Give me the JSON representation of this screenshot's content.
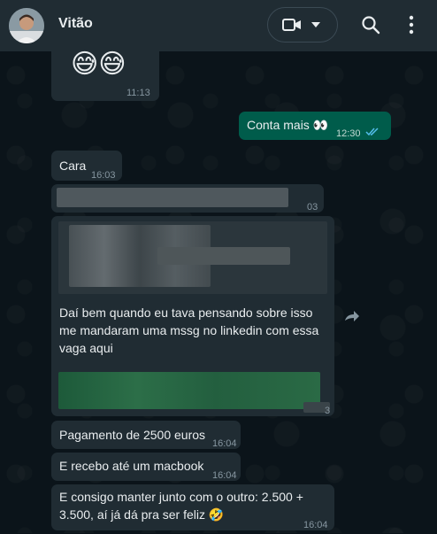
{
  "header": {
    "contact_name": "Vitão",
    "icons": {
      "video": "video-camera-icon",
      "dropdown": "chevron-down-icon",
      "search": "search-icon",
      "menu": "more-vertical-icon"
    }
  },
  "colors": {
    "header_bg": "#202c33",
    "incoming_bubble": "#202c33",
    "outgoing_bubble": "#005c4b",
    "read_ticks": "#53bdeb",
    "chat_bg": "#0b141a"
  },
  "messages": [
    {
      "id": "m0",
      "direction": "in",
      "content": "😅😅",
      "time": "11:13"
    },
    {
      "id": "m1",
      "direction": "out",
      "text": "Conta mais 👀",
      "time": "12:30",
      "status": "read"
    },
    {
      "id": "m2",
      "direction": "in",
      "text": "Cara",
      "time": "16:03"
    },
    {
      "id": "m3",
      "direction": "in",
      "text_blurred": true,
      "time_visible": "03"
    },
    {
      "id": "m4",
      "direction": "in",
      "text": "Daí bem quando eu tava pensando sobre isso me mandaram uma mssg no linkedin com essa vaga aqui",
      "lines": [
        "Daí bem quando eu tava pensando sobre isso",
        "me mandaram uma mssg no linkedin com essa",
        "vaga aqui"
      ],
      "time_visible": "3"
    },
    {
      "id": "m5",
      "direction": "in",
      "text": "Pagamento de 2500 euros",
      "time": "16:04"
    },
    {
      "id": "m6",
      "direction": "in",
      "text": "E recebo até um macbook",
      "time": "16:04"
    },
    {
      "id": "m7",
      "direction": "in",
      "text": "E consigo manter junto com o outro: 2.500 + 3.500, aí já dá pra ser feliz 🤣",
      "lines": [
        "E consigo manter junto com o outro: 2.500 +",
        "3.500, aí já dá pra ser feliz 🤣"
      ],
      "time": "16:04"
    }
  ]
}
